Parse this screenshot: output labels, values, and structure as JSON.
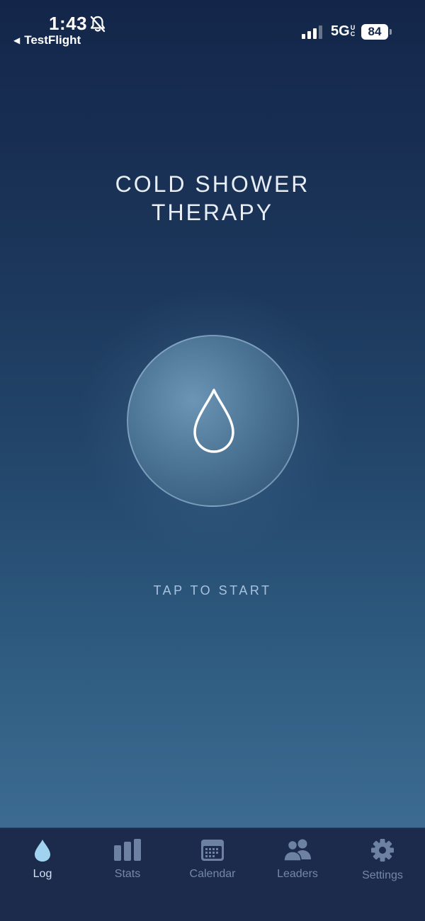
{
  "status_bar": {
    "time": "1:43",
    "back_label": "TestFlight",
    "network": "5G",
    "network_sup_top": "U",
    "network_sup_bottom": "C",
    "battery": "84"
  },
  "main": {
    "title_line1": "COLD SHOWER",
    "title_line2": "THERAPY",
    "tap_label": "TAP TO START"
  },
  "tabs": [
    {
      "label": "Log",
      "icon": "drop-icon",
      "active": true
    },
    {
      "label": "Stats",
      "icon": "bar-chart-icon",
      "active": false
    },
    {
      "label": "Calendar",
      "icon": "calendar-icon",
      "active": false
    },
    {
      "label": "Leaders",
      "icon": "people-icon",
      "active": false
    },
    {
      "label": "Settings",
      "icon": "gear-icon",
      "active": false
    }
  ],
  "colors": {
    "background_top": "#13264a",
    "background_bottom": "#44739a",
    "tab_bar": "#1c2b4c",
    "tab_active": "#9fd3ef",
    "tab_inactive": "#6d82a2"
  }
}
